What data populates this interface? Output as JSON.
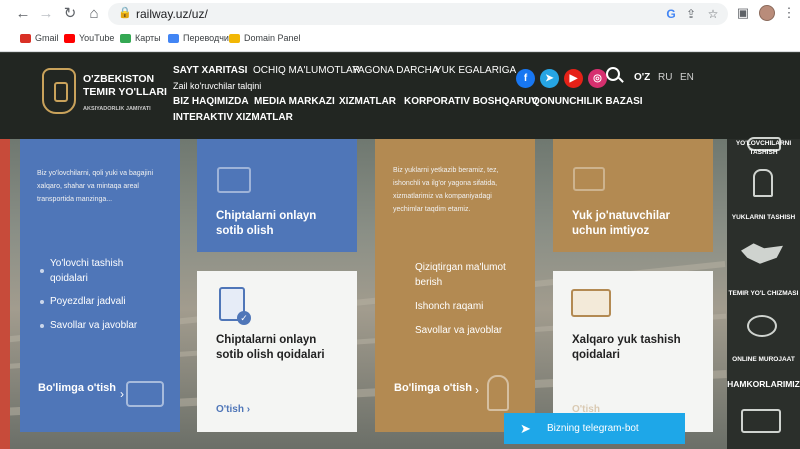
{
  "browser": {
    "url": "railway.uz/uz/",
    "bookmarks": [
      {
        "label": "Gmail",
        "color": "#d93025"
      },
      {
        "label": "YouTube",
        "color": "#ff0000"
      },
      {
        "label": "Карты",
        "color": "#34a853"
      },
      {
        "label": "Переводчик",
        "color": "#4285f4"
      },
      {
        "label": "Domain Panel",
        "color": "#f2b705"
      }
    ]
  },
  "header": {
    "logo_title": "O'ZBEKISTON TEMIR YO'LLARI",
    "logo_subtitle": "AKSIYADORLIK JAMIYATI",
    "top_links": [
      "SAYT XARITASI",
      "OCHIQ MA'LUMOTLAR",
      "YAGONA DARCHA",
      "YUK EGALARIGA"
    ],
    "top_link_sub": "Zail ko'ruvchilar talqini",
    "main_menu_row1": [
      "BIZ HAQIMIZDA",
      "MEDIA MARKAZI",
      "XIZMATLAR",
      "KORPORATIV BOSHQARUV",
      "QONUNCHILIK BAZASI"
    ],
    "main_menu_row2": [
      "INTERAKTIV XIZMATLAR"
    ],
    "languages": [
      "O'Z",
      "RU",
      "EN"
    ],
    "social": [
      {
        "icon": "facebook-icon",
        "glyph": "f",
        "color": "#1877f2"
      },
      {
        "icon": "telegram-icon",
        "glyph": "➤",
        "color": "#26a5e4"
      },
      {
        "icon": "youtube-icon",
        "glyph": "▶",
        "color": "#e62117"
      },
      {
        "icon": "instagram-icon",
        "glyph": "◎",
        "color": "#d6306f"
      }
    ]
  },
  "cards": {
    "passengers": {
      "intro": "Biz yo'lovchilarni, qoli yuki va bagajini xalqaro, shahar va mintaqa areal transportida manzinga...",
      "links": [
        "Yo'lovchi tashish qoidalari",
        "Poyezdlar jadvali",
        "Savollar va javoblar"
      ],
      "more": "Bo'limga o'tish"
    },
    "tickets_online": {
      "title": "Chiptalarni onlayn sotib olish"
    },
    "tickets_rules": {
      "title": "Chiptalarni onlayn sotib olish qoidalari",
      "more": "O'tish"
    },
    "cargo": {
      "intro": "Biz yuklarni yetkazib beramiz, tez, ishonchli va ilg'or yagona sifatida, xizmatlarimiz va kompaniyadagi yechimlar taqdim etamiz.",
      "links": [
        "Qiziqtirgan ma'lumot berish",
        "Ishonch raqami",
        "Savollar va javoblar"
      ],
      "more": "Bo'limga o'tish"
    },
    "shippers_benefits": {
      "title": "Yuk jo'natuvchilar uchun imtiyoz"
    },
    "international_cargo": {
      "title": "Xalqaro yuk tashish qoidalari",
      "more": "O'tish"
    }
  },
  "sidebar": [
    {
      "label": "YO'LOVCHILARNI TASHISH",
      "icon": "train-icon"
    },
    {
      "label": "YUKLARNI TASHISH",
      "icon": "locomotive-icon"
    },
    {
      "label": "TEMIR YO'L CHIZMASI",
      "icon": "map-icon"
    },
    {
      "label": "ONLINE MUROJAAT",
      "icon": "chat-icon"
    },
    {
      "label": "HAMKORLARIMIZ",
      "icon": "truck-icon"
    }
  ],
  "telegram_bar": {
    "label": "Bizning telegram-bot"
  },
  "colors": {
    "blue": "#4f76b8",
    "gold": "#b38a52",
    "white_card": "#f4f5f3",
    "dark": "#222622",
    "telegram": "#1ea7e8"
  }
}
